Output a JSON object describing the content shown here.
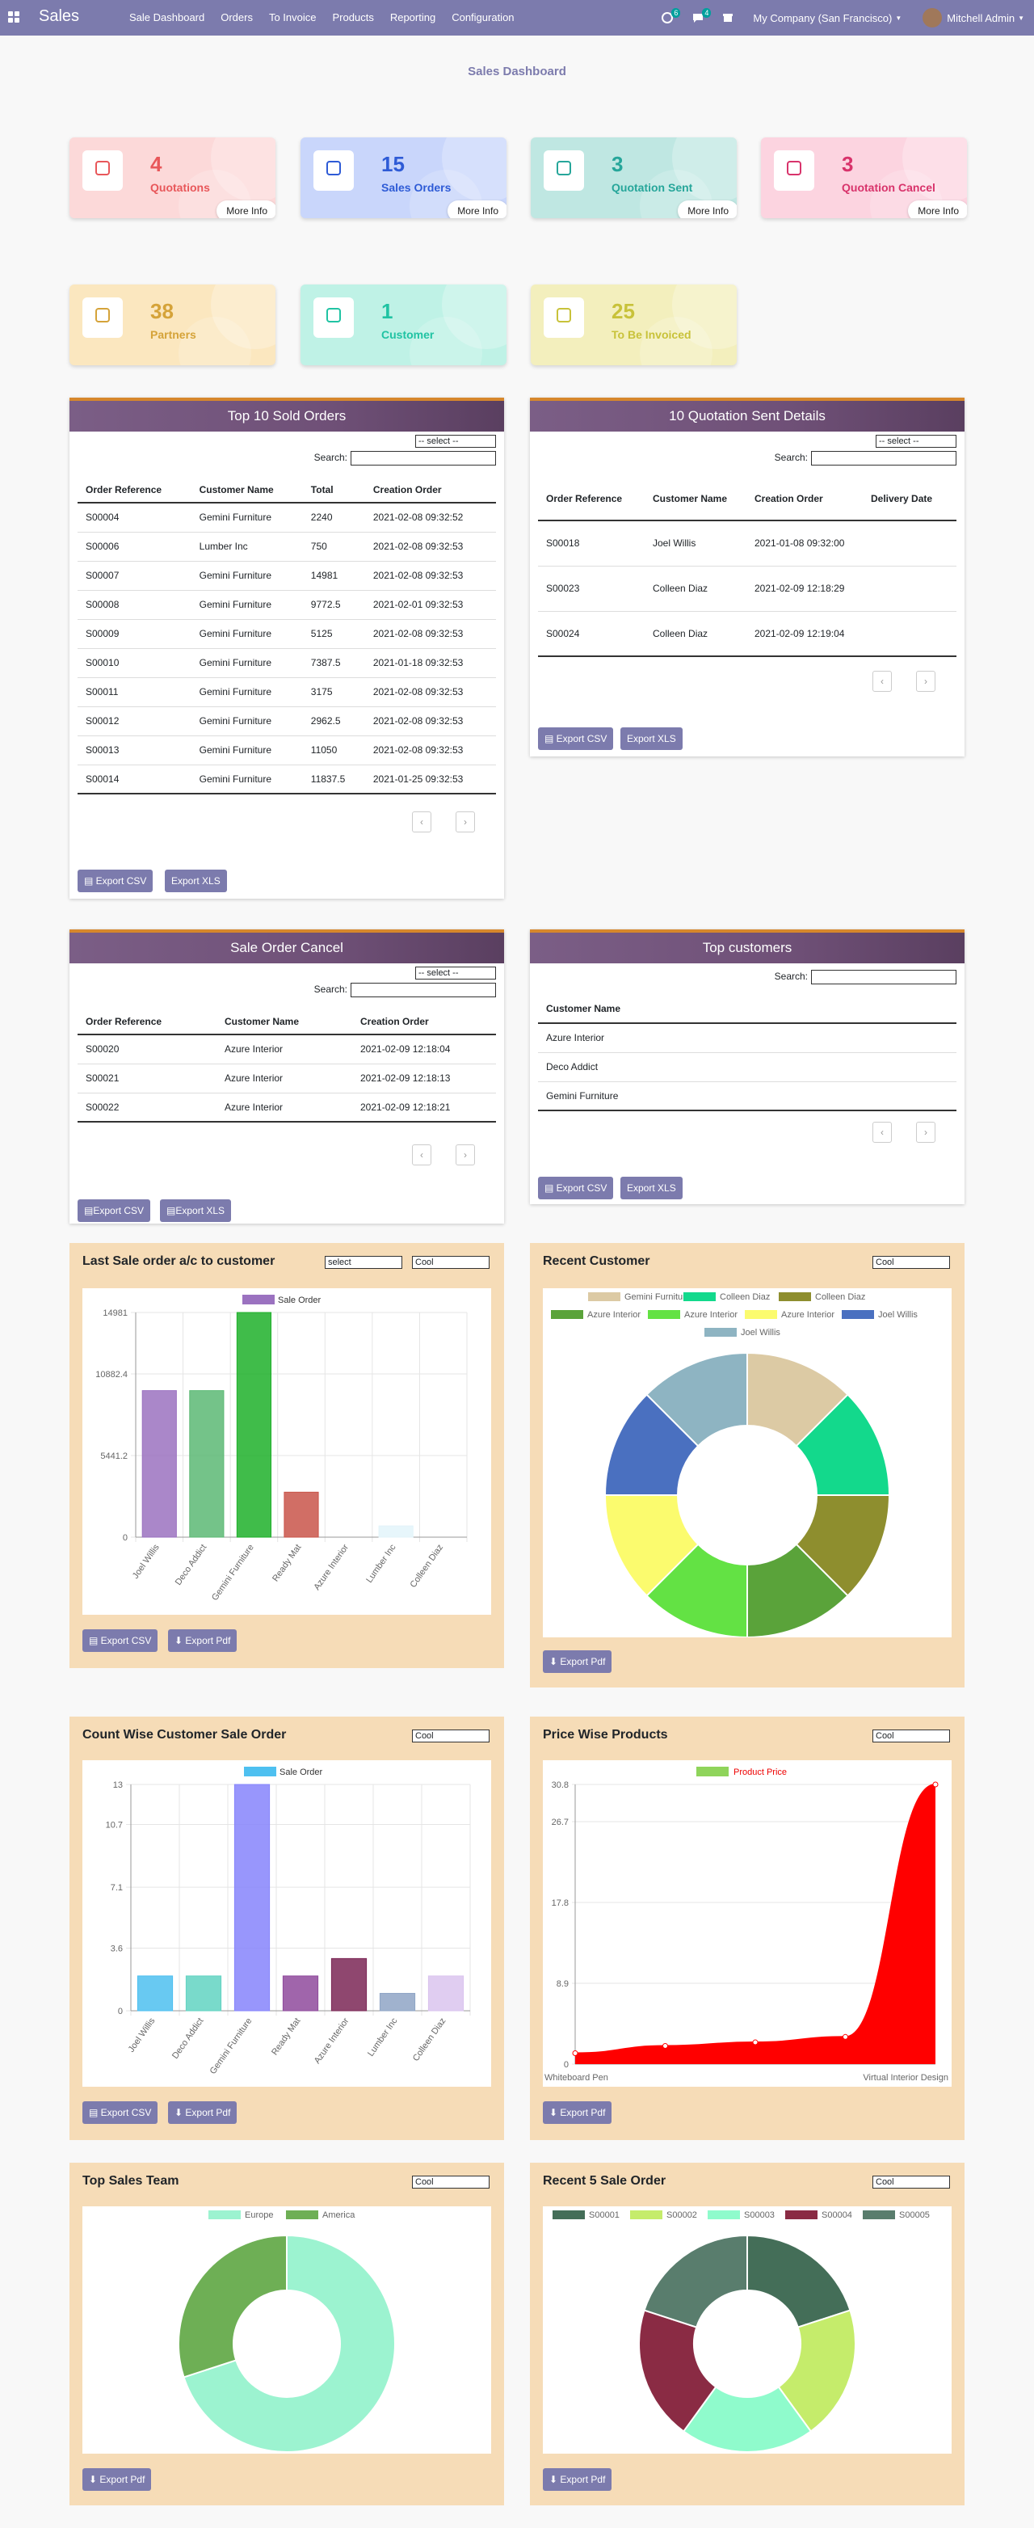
{
  "nav": {
    "brand": "Sales",
    "menu": [
      "Sale Dashboard",
      "Orders",
      "To Invoice",
      "Products",
      "Reporting",
      "Configuration"
    ],
    "badge1": "6",
    "badge2": "4",
    "company": "My Company (San Francisco)",
    "user": "Mitchell Admin"
  },
  "page_title": "Sales Dashboard",
  "stats": [
    {
      "value": "4",
      "label": "Quotations",
      "more": "More Info",
      "color": "#e8575a",
      "bg": "#fcd9d9"
    },
    {
      "value": "15",
      "label": "Sales Orders",
      "more": "More Info",
      "color": "#2e5bd6",
      "bg": "#c9d6fb"
    },
    {
      "value": "3",
      "label": "Quotation Sent",
      "more": "More Info",
      "color": "#26a69a",
      "bg": "#bfe7e2"
    },
    {
      "value": "3",
      "label": "Quotation Cancel",
      "more": "More Info",
      "color": "#d8336b",
      "bg": "#fcd4e0"
    },
    {
      "value": "38",
      "label": "Partners",
      "color": "#d5a339",
      "bg": "#fbe7bf"
    },
    {
      "value": "1",
      "label": "Customer",
      "color": "#20c3a3",
      "bg": "#bff2e6"
    },
    {
      "value": "25",
      "label": "To Be Invoiced",
      "color": "#c8c23a",
      "bg": "#f3efbd"
    }
  ],
  "common": {
    "select": "-- select --",
    "search": "Search:",
    "prev": "‹",
    "next": "›",
    "csv": "Export CSV",
    "xls": "Export XLS",
    "pdf": "Export Pdf"
  },
  "top_sold": {
    "title": "Top 10 Sold Orders",
    "headers": [
      "Order Reference",
      "Customer Name",
      "Total",
      "Creation Order"
    ],
    "rows": [
      [
        "S00004",
        "Gemini Furniture",
        "2240",
        "2021-02-08 09:32:52"
      ],
      [
        "S00006",
        "Lumber Inc",
        "750",
        "2021-02-08 09:32:53"
      ],
      [
        "S00007",
        "Gemini Furniture",
        "14981",
        "2021-02-08 09:32:53"
      ],
      [
        "S00008",
        "Gemini Furniture",
        "9772.5",
        "2021-02-01 09:32:53"
      ],
      [
        "S00009",
        "Gemini Furniture",
        "5125",
        "2021-02-08 09:32:53"
      ],
      [
        "S00010",
        "Gemini Furniture",
        "7387.5",
        "2021-01-18 09:32:53"
      ],
      [
        "S00011",
        "Gemini Furniture",
        "3175",
        "2021-02-08 09:32:53"
      ],
      [
        "S00012",
        "Gemini Furniture",
        "2962.5",
        "2021-02-08 09:32:53"
      ],
      [
        "S00013",
        "Gemini Furniture",
        "11050",
        "2021-02-08 09:32:53"
      ],
      [
        "S00014",
        "Gemini Furniture",
        "11837.5",
        "2021-01-25 09:32:53"
      ]
    ]
  },
  "quot_sent": {
    "title": "10 Quotation Sent Details",
    "headers": [
      "Order Reference",
      "Customer Name",
      "Creation Order",
      "Delivery Date"
    ],
    "rows": [
      [
        "S00018",
        "Joel Willis",
        "2021-01-08 09:32:00",
        ""
      ],
      [
        "S00023",
        "Colleen Diaz",
        "2021-02-09 12:18:29",
        ""
      ],
      [
        "S00024",
        "Colleen Diaz",
        "2021-02-09 12:19:04",
        ""
      ]
    ]
  },
  "cancel": {
    "title": "Sale Order Cancel",
    "headers": [
      "Order Reference",
      "Customer Name",
      "Creation Order"
    ],
    "rows": [
      [
        "S00020",
        "Azure Interior",
        "2021-02-09 12:18:04"
      ],
      [
        "S00021",
        "Azure Interior",
        "2021-02-09 12:18:13"
      ],
      [
        "S00022",
        "Azure Interior",
        "2021-02-09 12:18:21"
      ]
    ]
  },
  "top_customers": {
    "title": "Top customers",
    "headers": [
      "Customer Name"
    ],
    "rows": [
      [
        "Azure Interior"
      ],
      [
        "Deco Addict"
      ],
      [
        "Gemini Furniture"
      ]
    ]
  },
  "last_sale": {
    "title": "Last Sale order a/c to customer",
    "select1": "select",
    "select2": "Cool"
  },
  "recent_customer": {
    "title": "Recent Customer",
    "select": "Cool"
  },
  "count_wise": {
    "title": "Count Wise Customer Sale Order",
    "select": "Cool"
  },
  "price_wise": {
    "title": "Price Wise Products",
    "select": "Cool"
  },
  "top_team": {
    "title": "Top Sales Team",
    "select": "Cool"
  },
  "recent5": {
    "title": "Recent 5 Sale Order",
    "select": "Cool"
  },
  "chart_data": [
    {
      "type": "bar",
      "legend": "Sale Order",
      "categories": [
        "Joel Willis",
        "Deco Addict",
        "Gemini Furniture",
        "Ready Mat",
        "Azure Interior",
        "Lumber Inc",
        "Colleen Diaz"
      ],
      "values": [
        9772.5,
        9772.5,
        14981,
        3000,
        0,
        750,
        0
      ],
      "colors": [
        "#9b72c0",
        "#5cb974",
        "#1eb02a",
        "#c9554a",
        "#d9d9d9",
        "#e3f4fa",
        "#eeeeee"
      ],
      "yticks": [
        "0",
        "5441.2",
        "10882.4",
        "14981"
      ],
      "ylim": [
        0,
        14981
      ]
    },
    {
      "type": "pie",
      "donut": true,
      "labels": [
        "Gemini Furniture",
        "Colleen Diaz",
        "Colleen Diaz",
        "Azure Interior",
        "Azure Interior",
        "Azure Interior",
        "Joel Willis",
        "Joel Willis"
      ],
      "values": [
        1,
        1,
        1,
        1,
        1,
        1,
        1,
        1
      ],
      "colors": [
        "#dccaa4",
        "#13d98c",
        "#8e8e2e",
        "#5aa33a",
        "#63e244",
        "#fbfb6e",
        "#4a70c0",
        "#8eb4c2"
      ]
    },
    {
      "type": "bar",
      "legend": "Sale Order",
      "categories": [
        "Joel Willis",
        "Deco Addict",
        "Gemini Furniture",
        "Ready Mat",
        "Azure Interior",
        "Lumber Inc",
        "Colleen Diaz"
      ],
      "values": [
        2,
        2,
        13,
        2,
        3,
        1,
        2
      ],
      "colors": [
        "#4ec0f0",
        "#62d3c2",
        "#8684fb",
        "#8f4a9c",
        "#7b2756",
        "#8fa5c6",
        "#dac4ee"
      ],
      "yticks": [
        "0",
        "3.6",
        "7.1",
        "10.7",
        "13"
      ],
      "ylim": [
        0,
        13
      ]
    },
    {
      "type": "area",
      "legend": "Product Price",
      "x": [
        "Whiteboard Pen",
        "",
        "",
        "",
        "Virtual Interior Design"
      ],
      "values": [
        1.2,
        2.0,
        2.4,
        3.0,
        30.8
      ],
      "yticks": [
        "0",
        "8.9",
        "17.8",
        "26.7",
        "30.8"
      ],
      "ylim": [
        0,
        30.8
      ],
      "color": "#ff0000"
    },
    {
      "type": "pie",
      "donut": true,
      "labels": [
        "Europe",
        "America"
      ],
      "values": [
        70,
        30
      ],
      "colors": [
        "#9cf3d0",
        "#6eaf55"
      ]
    },
    {
      "type": "pie",
      "donut": true,
      "labels": [
        "S00001",
        "S00002",
        "S00003",
        "S00004",
        "S00005"
      ],
      "values": [
        20,
        20,
        20,
        20,
        20
      ],
      "colors": [
        "#446e58",
        "#c5ec6b",
        "#8ffbcc",
        "#8a2b44",
        "#597d6d"
      ]
    }
  ]
}
